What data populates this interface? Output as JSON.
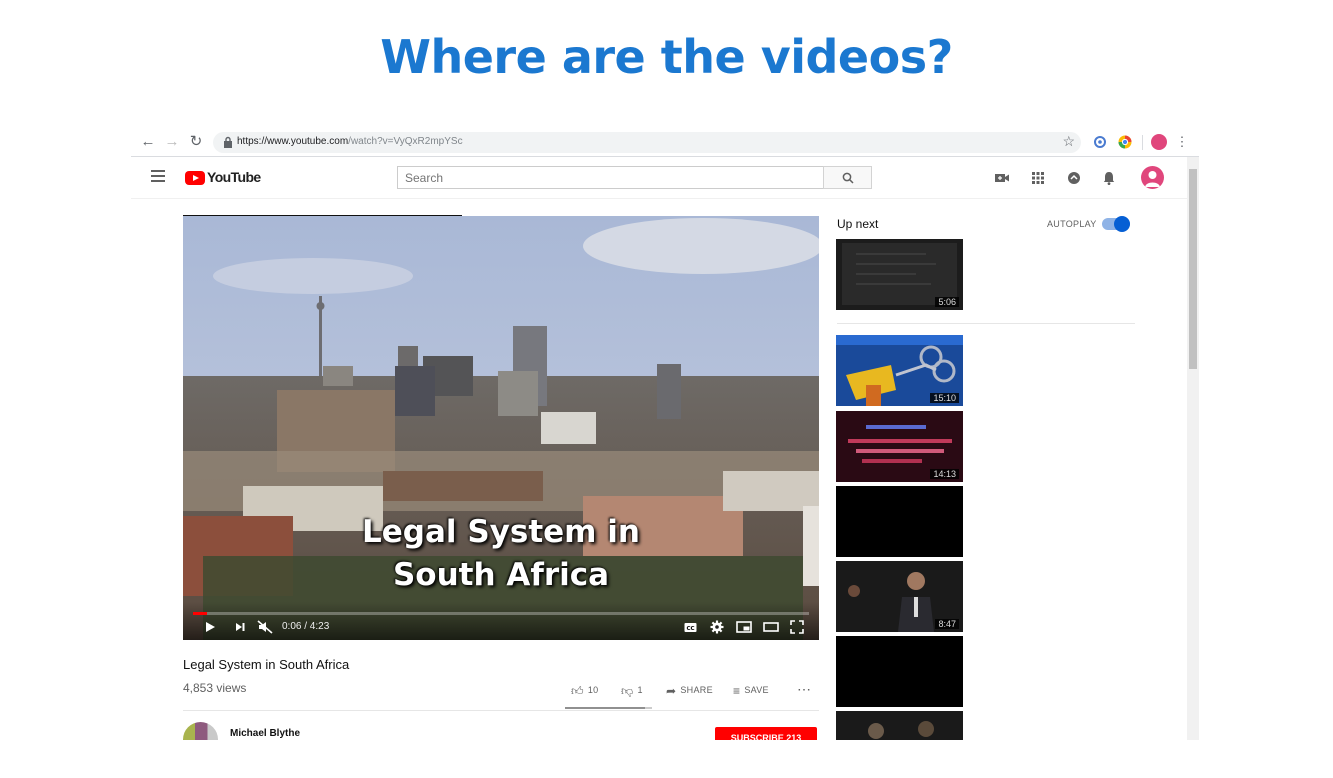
{
  "slide": {
    "title": "Where are the videos?"
  },
  "browser": {
    "url_host": "https://www.youtube.com",
    "url_path": "/watch?v=VyQxR2mpYSc"
  },
  "youtube": {
    "logo_text": "YouTube",
    "search": {
      "placeholder": "Search"
    },
    "header_icons": [
      "create-video-icon",
      "apps-grid-icon",
      "messages-icon",
      "notifications-bell-icon"
    ]
  },
  "player": {
    "caption_line1": "Legal System in",
    "caption_line2": "South Africa",
    "time_display": "0:06 / 4:23",
    "progress": 0.023
  },
  "video": {
    "title": "Legal System in South Africa",
    "views": "4,853 views",
    "likes": "10",
    "dislikes": "1",
    "share_label": "SHARE",
    "save_label": "SAVE"
  },
  "channel": {
    "name": "Michael Blythe",
    "subscribe_label": "SUBSCRIBE 213"
  },
  "sidebar": {
    "up_next_label": "Up next",
    "autoplay_label": "AUTOPLAY",
    "autoplay_on": true,
    "thumbnails": [
      {
        "duration": "5:06"
      },
      {
        "duration": "15:10"
      },
      {
        "duration": "14:13"
      },
      {
        "duration": ""
      },
      {
        "duration": "8:47"
      },
      {
        "duration": ""
      },
      {
        "duration": ""
      }
    ]
  }
}
